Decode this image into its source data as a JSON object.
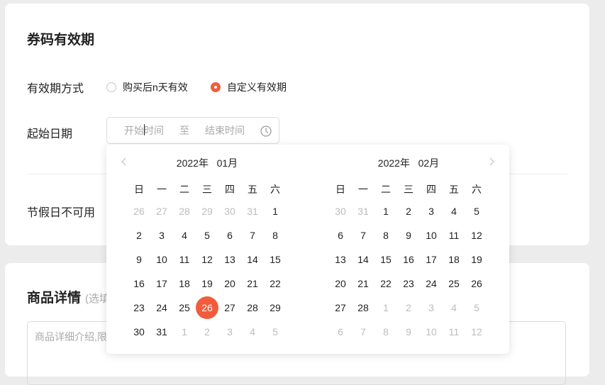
{
  "coupon_section": {
    "title": "券码有效期",
    "validity_mode": {
      "label": "有效期方式",
      "options": [
        {
          "label": "购买后n天有效",
          "selected": false
        },
        {
          "label": "自定义有效期",
          "selected": true
        }
      ]
    },
    "date_range": {
      "label": "起始日期",
      "start_placeholder": "开始时间",
      "separator": "至",
      "end_placeholder": "结束时间",
      "icon": "clock-icon"
    },
    "holiday": {
      "label": "节假日不可用"
    }
  },
  "product_section": {
    "title": "商品详情",
    "note": "(选填)",
    "detail_placeholder": "商品详细介绍,限"
  },
  "date_picker": {
    "weekdays": [
      "日",
      "一",
      "二",
      "三",
      "四",
      "五",
      "六"
    ],
    "left": {
      "title": "2022年   01月",
      "days": [
        {
          "d": "26",
          "m": true
        },
        {
          "d": "27",
          "m": true
        },
        {
          "d": "28",
          "m": true
        },
        {
          "d": "29",
          "m": true
        },
        {
          "d": "30",
          "m": true
        },
        {
          "d": "31",
          "m": true
        },
        {
          "d": "1"
        },
        {
          "d": "2"
        },
        {
          "d": "3"
        },
        {
          "d": "4"
        },
        {
          "d": "5"
        },
        {
          "d": "6"
        },
        {
          "d": "7"
        },
        {
          "d": "8"
        },
        {
          "d": "9"
        },
        {
          "d": "10"
        },
        {
          "d": "11"
        },
        {
          "d": "12"
        },
        {
          "d": "13"
        },
        {
          "d": "14"
        },
        {
          "d": "15"
        },
        {
          "d": "16"
        },
        {
          "d": "17"
        },
        {
          "d": "18"
        },
        {
          "d": "19"
        },
        {
          "d": "20"
        },
        {
          "d": "21"
        },
        {
          "d": "22"
        },
        {
          "d": "23"
        },
        {
          "d": "24"
        },
        {
          "d": "25"
        },
        {
          "d": "26",
          "s": true
        },
        {
          "d": "27"
        },
        {
          "d": "28"
        },
        {
          "d": "29"
        },
        {
          "d": "30"
        },
        {
          "d": "31"
        },
        {
          "d": "1",
          "m": true
        },
        {
          "d": "2",
          "m": true
        },
        {
          "d": "3",
          "m": true
        },
        {
          "d": "4",
          "m": true
        },
        {
          "d": "5",
          "m": true
        }
      ]
    },
    "right": {
      "title": "2022年   02月",
      "days": [
        {
          "d": "30",
          "m": true
        },
        {
          "d": "31",
          "m": true
        },
        {
          "d": "1"
        },
        {
          "d": "2"
        },
        {
          "d": "3"
        },
        {
          "d": "4"
        },
        {
          "d": "5"
        },
        {
          "d": "6"
        },
        {
          "d": "7"
        },
        {
          "d": "8"
        },
        {
          "d": "9"
        },
        {
          "d": "10"
        },
        {
          "d": "11"
        },
        {
          "d": "12"
        },
        {
          "d": "13"
        },
        {
          "d": "14"
        },
        {
          "d": "15"
        },
        {
          "d": "16"
        },
        {
          "d": "17"
        },
        {
          "d": "18"
        },
        {
          "d": "19"
        },
        {
          "d": "20"
        },
        {
          "d": "21"
        },
        {
          "d": "22"
        },
        {
          "d": "23"
        },
        {
          "d": "24"
        },
        {
          "d": "25"
        },
        {
          "d": "26"
        },
        {
          "d": "27"
        },
        {
          "d": "28"
        },
        {
          "d": "1",
          "m": true
        },
        {
          "d": "2",
          "m": true
        },
        {
          "d": "3",
          "m": true
        },
        {
          "d": "4",
          "m": true
        },
        {
          "d": "5",
          "m": true
        },
        {
          "d": "6",
          "m": true
        },
        {
          "d": "7",
          "m": true
        },
        {
          "d": "8",
          "m": true
        },
        {
          "d": "9",
          "m": true
        },
        {
          "d": "10",
          "m": true
        },
        {
          "d": "11",
          "m": true
        },
        {
          "d": "12",
          "m": true
        }
      ]
    },
    "prev_icon": "chevron-left-icon",
    "next_icon": "chevron-right-icon"
  },
  "colors": {
    "accent": "#f25c3c",
    "muted_text": "#bcbcbc"
  }
}
